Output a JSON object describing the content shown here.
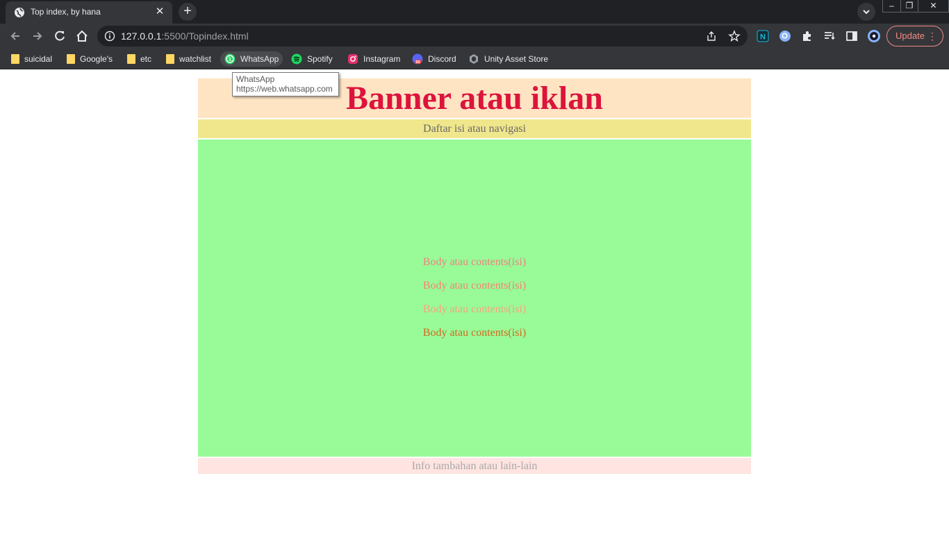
{
  "browser": {
    "tab_title": "Top index, by hana",
    "url_host": "127.0.0.1",
    "url_rest": ":5500/Topindex.html",
    "update_label": "Update",
    "bookmarks": [
      {
        "label": "suicidal",
        "icon": "folder-icon"
      },
      {
        "label": "Google's",
        "icon": "folder-icon"
      },
      {
        "label": "etc",
        "icon": "folder-icon"
      },
      {
        "label": "watchlist",
        "icon": "folder-icon"
      },
      {
        "label": "WhatsApp",
        "icon": "whatsapp-icon"
      },
      {
        "label": "Spotify",
        "icon": "spotify-icon"
      },
      {
        "label": "Instagram",
        "icon": "instagram-icon"
      },
      {
        "label": "Discord",
        "icon": "discord-icon"
      },
      {
        "label": "Unity Asset Store",
        "icon": "unity-icon"
      }
    ],
    "tooltip": {
      "title": "WhatsApp",
      "url": "https://web.whatsapp.com"
    }
  },
  "page": {
    "banner": "Banner atau iklan",
    "nav": "Daftar isi atau navigasi",
    "body_lines": [
      {
        "text": "Body atau contents(isi)",
        "color": "#f08080"
      },
      {
        "text": "Body atau contents(isi)",
        "color": "#fa8072"
      },
      {
        "text": "Body atau contents(isi)",
        "color": "#ffa07a"
      },
      {
        "text": "Body atau contents(isi)",
        "color": "#d2691e"
      }
    ],
    "footer": "Info tambahan atau lain-lain"
  },
  "colors": {
    "banner_bg": "#ffe4c4",
    "banner_text": "#dc143c",
    "nav_bg": "#f0e68c",
    "content_bg": "#98fb98",
    "footer_bg": "#ffe4e1"
  }
}
